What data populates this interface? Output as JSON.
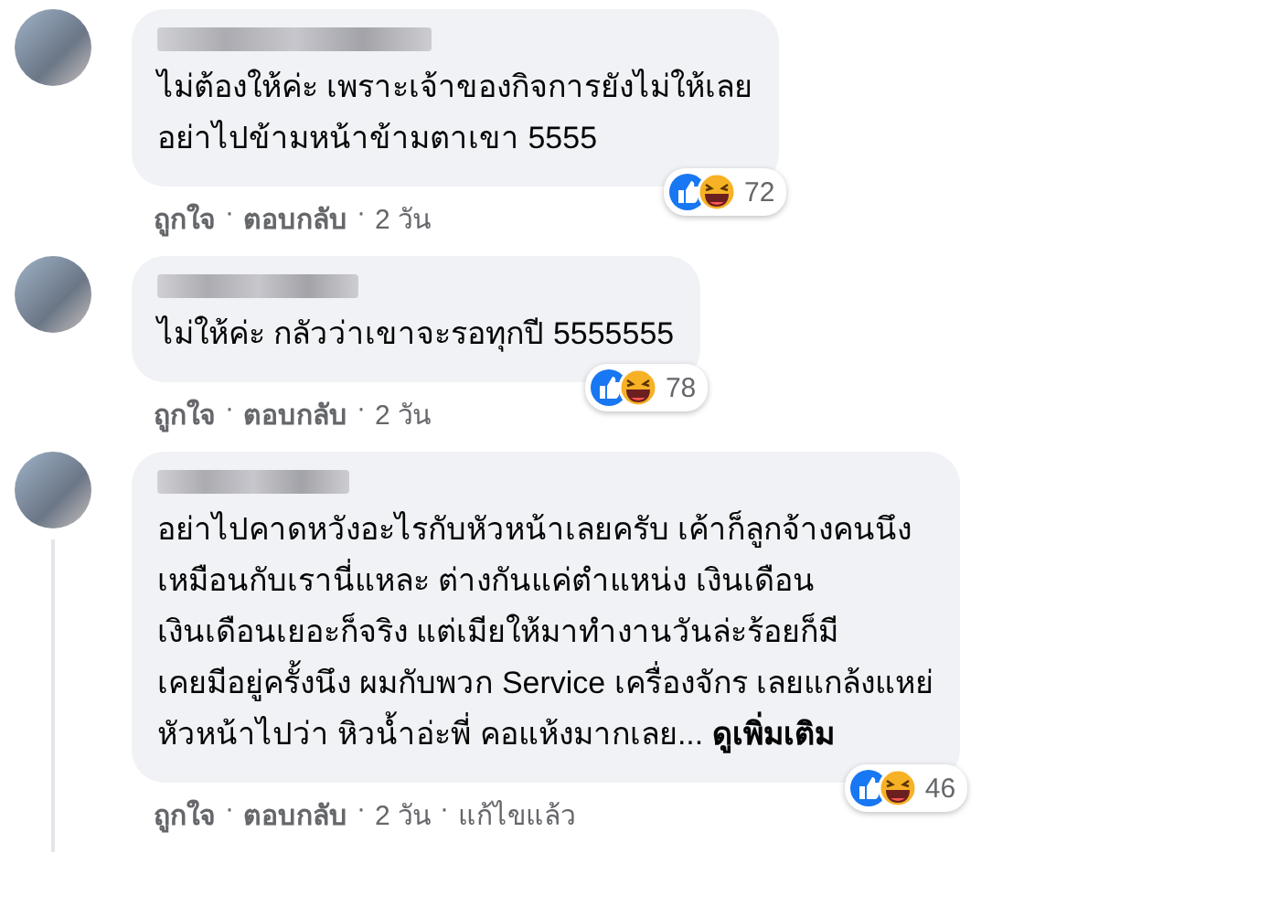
{
  "comments": [
    {
      "body": "ไม่ต้องให้ค่ะ เพราะเจ้าของกิจการยังไม่ให้เลย\nอย่าไปข้ามหน้าข้ามตาเขา 5555",
      "reaction_count": "72",
      "actions": [
        "ถูกใจ",
        "ตอบกลับ",
        "2 วัน"
      ],
      "separator": "·",
      "thread_line": false
    },
    {
      "body": "ไม่ให้ค่ะ กลัวว่าเขาจะรอทุกปี 5555555",
      "reaction_count": "78",
      "actions": [
        "ถูกใจ",
        "ตอบกลับ",
        "2 วัน"
      ],
      "separator": "·",
      "thread_line": false
    },
    {
      "body": "อย่าไปคาดหวังอะไรกับหัวหน้าเลยครับ เค้าก็ลูกจ้างคนนึง\nเหมือนกับเรานี่แหละ ต่างกันแค่ตำแหน่ง เงินเดือน\nเงินเดือนเยอะก็จริง แต่เมียให้มาทำงานวันล่ะร้อยก็มี\nเคยมีอยู่ครั้งนึง ผมกับพวก Service เครื่องจักร เลยแกล้งแหย่\nหัวหน้าไปว่า หิวน้ำอ่ะพี่ คอแห้งมากเลย...",
      "see_more": "ดูเพิ่มเติม",
      "reaction_count": "46",
      "actions": [
        "ถูกใจ",
        "ตอบกลับ",
        "2 วัน",
        "แก้ไขแล้ว"
      ],
      "separator": "·",
      "thread_line": true
    }
  ]
}
